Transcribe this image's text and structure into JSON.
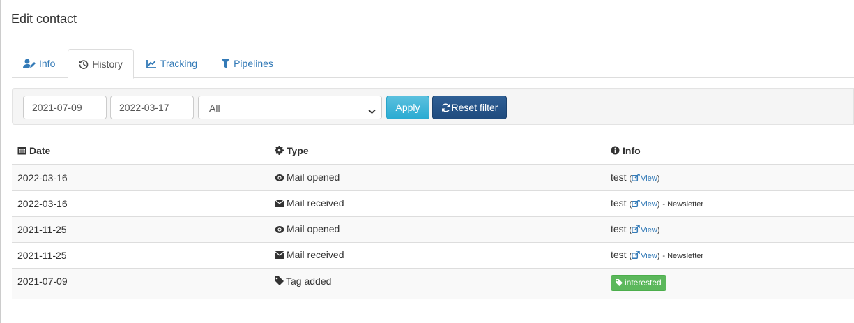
{
  "modal": {
    "title": "Edit contact"
  },
  "tabs": [
    {
      "label": "Info",
      "icon": "user-edit-icon",
      "active": false
    },
    {
      "label": "History",
      "icon": "history-icon",
      "active": true
    },
    {
      "label": "Tracking",
      "icon": "line-chart-icon",
      "active": false
    },
    {
      "label": "Pipelines",
      "icon": "filter-icon",
      "active": false
    }
  ],
  "filter": {
    "date_from": "2021-07-09",
    "date_to": "2022-03-17",
    "type_selected": "All",
    "apply_label": "Apply",
    "reset_label": "Reset filter"
  },
  "table": {
    "headers": {
      "date": "Date",
      "type": "Type",
      "info": "Info"
    },
    "rows": [
      {
        "date": "2022-03-16",
        "type": "Mail opened",
        "type_icon": "eye-icon",
        "info_name": "test",
        "info_link": "View",
        "info_suffix": ""
      },
      {
        "date": "2022-03-16",
        "type": "Mail received",
        "type_icon": "envelope-icon",
        "info_name": "test",
        "info_link": "View",
        "info_suffix": "- Newsletter"
      },
      {
        "date": "2021-11-25",
        "type": "Mail opened",
        "type_icon": "eye-icon",
        "info_name": "test",
        "info_link": "View",
        "info_suffix": ""
      },
      {
        "date": "2021-11-25",
        "type": "Mail received",
        "type_icon": "envelope-icon",
        "info_name": "test",
        "info_link": "View",
        "info_suffix": "- Newsletter"
      },
      {
        "date": "2021-07-09",
        "type": "Tag added",
        "type_icon": "tag-icon",
        "tag_label": "interested"
      }
    ]
  },
  "colors": {
    "link": "#337ab7",
    "apply": "#31b0d5",
    "reset": "#265a88",
    "tag": "#5cb85c"
  }
}
